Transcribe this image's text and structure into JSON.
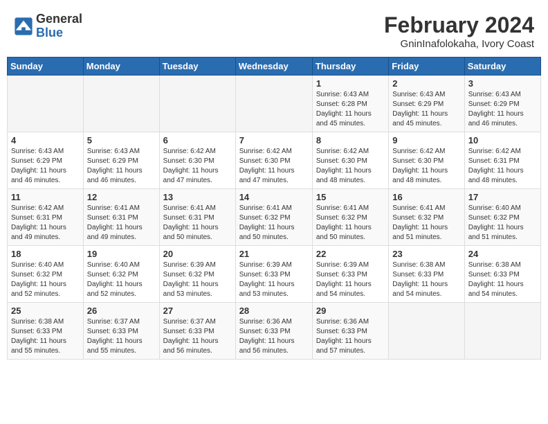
{
  "header": {
    "logo_general": "General",
    "logo_blue": "Blue",
    "month_year": "February 2024",
    "location": "GninInafolokaha, Ivory Coast"
  },
  "weekdays": [
    "Sunday",
    "Monday",
    "Tuesday",
    "Wednesday",
    "Thursday",
    "Friday",
    "Saturday"
  ],
  "weeks": [
    [
      {
        "day": "",
        "info": ""
      },
      {
        "day": "",
        "info": ""
      },
      {
        "day": "",
        "info": ""
      },
      {
        "day": "",
        "info": ""
      },
      {
        "day": "1",
        "info": "Sunrise: 6:43 AM\nSunset: 6:28 PM\nDaylight: 11 hours\nand 45 minutes."
      },
      {
        "day": "2",
        "info": "Sunrise: 6:43 AM\nSunset: 6:29 PM\nDaylight: 11 hours\nand 45 minutes."
      },
      {
        "day": "3",
        "info": "Sunrise: 6:43 AM\nSunset: 6:29 PM\nDaylight: 11 hours\nand 46 minutes."
      }
    ],
    [
      {
        "day": "4",
        "info": "Sunrise: 6:43 AM\nSunset: 6:29 PM\nDaylight: 11 hours\nand 46 minutes."
      },
      {
        "day": "5",
        "info": "Sunrise: 6:43 AM\nSunset: 6:29 PM\nDaylight: 11 hours\nand 46 minutes."
      },
      {
        "day": "6",
        "info": "Sunrise: 6:42 AM\nSunset: 6:30 PM\nDaylight: 11 hours\nand 47 minutes."
      },
      {
        "day": "7",
        "info": "Sunrise: 6:42 AM\nSunset: 6:30 PM\nDaylight: 11 hours\nand 47 minutes."
      },
      {
        "day": "8",
        "info": "Sunrise: 6:42 AM\nSunset: 6:30 PM\nDaylight: 11 hours\nand 48 minutes."
      },
      {
        "day": "9",
        "info": "Sunrise: 6:42 AM\nSunset: 6:30 PM\nDaylight: 11 hours\nand 48 minutes."
      },
      {
        "day": "10",
        "info": "Sunrise: 6:42 AM\nSunset: 6:31 PM\nDaylight: 11 hours\nand 48 minutes."
      }
    ],
    [
      {
        "day": "11",
        "info": "Sunrise: 6:42 AM\nSunset: 6:31 PM\nDaylight: 11 hours\nand 49 minutes."
      },
      {
        "day": "12",
        "info": "Sunrise: 6:41 AM\nSunset: 6:31 PM\nDaylight: 11 hours\nand 49 minutes."
      },
      {
        "day": "13",
        "info": "Sunrise: 6:41 AM\nSunset: 6:31 PM\nDaylight: 11 hours\nand 50 minutes."
      },
      {
        "day": "14",
        "info": "Sunrise: 6:41 AM\nSunset: 6:32 PM\nDaylight: 11 hours\nand 50 minutes."
      },
      {
        "day": "15",
        "info": "Sunrise: 6:41 AM\nSunset: 6:32 PM\nDaylight: 11 hours\nand 50 minutes."
      },
      {
        "day": "16",
        "info": "Sunrise: 6:41 AM\nSunset: 6:32 PM\nDaylight: 11 hours\nand 51 minutes."
      },
      {
        "day": "17",
        "info": "Sunrise: 6:40 AM\nSunset: 6:32 PM\nDaylight: 11 hours\nand 51 minutes."
      }
    ],
    [
      {
        "day": "18",
        "info": "Sunrise: 6:40 AM\nSunset: 6:32 PM\nDaylight: 11 hours\nand 52 minutes."
      },
      {
        "day": "19",
        "info": "Sunrise: 6:40 AM\nSunset: 6:32 PM\nDaylight: 11 hours\nand 52 minutes."
      },
      {
        "day": "20",
        "info": "Sunrise: 6:39 AM\nSunset: 6:32 PM\nDaylight: 11 hours\nand 53 minutes."
      },
      {
        "day": "21",
        "info": "Sunrise: 6:39 AM\nSunset: 6:33 PM\nDaylight: 11 hours\nand 53 minutes."
      },
      {
        "day": "22",
        "info": "Sunrise: 6:39 AM\nSunset: 6:33 PM\nDaylight: 11 hours\nand 54 minutes."
      },
      {
        "day": "23",
        "info": "Sunrise: 6:38 AM\nSunset: 6:33 PM\nDaylight: 11 hours\nand 54 minutes."
      },
      {
        "day": "24",
        "info": "Sunrise: 6:38 AM\nSunset: 6:33 PM\nDaylight: 11 hours\nand 54 minutes."
      }
    ],
    [
      {
        "day": "25",
        "info": "Sunrise: 6:38 AM\nSunset: 6:33 PM\nDaylight: 11 hours\nand 55 minutes."
      },
      {
        "day": "26",
        "info": "Sunrise: 6:37 AM\nSunset: 6:33 PM\nDaylight: 11 hours\nand 55 minutes."
      },
      {
        "day": "27",
        "info": "Sunrise: 6:37 AM\nSunset: 6:33 PM\nDaylight: 11 hours\nand 56 minutes."
      },
      {
        "day": "28",
        "info": "Sunrise: 6:36 AM\nSunset: 6:33 PM\nDaylight: 11 hours\nand 56 minutes."
      },
      {
        "day": "29",
        "info": "Sunrise: 6:36 AM\nSunset: 6:33 PM\nDaylight: 11 hours\nand 57 minutes."
      },
      {
        "day": "",
        "info": ""
      },
      {
        "day": "",
        "info": ""
      }
    ]
  ]
}
